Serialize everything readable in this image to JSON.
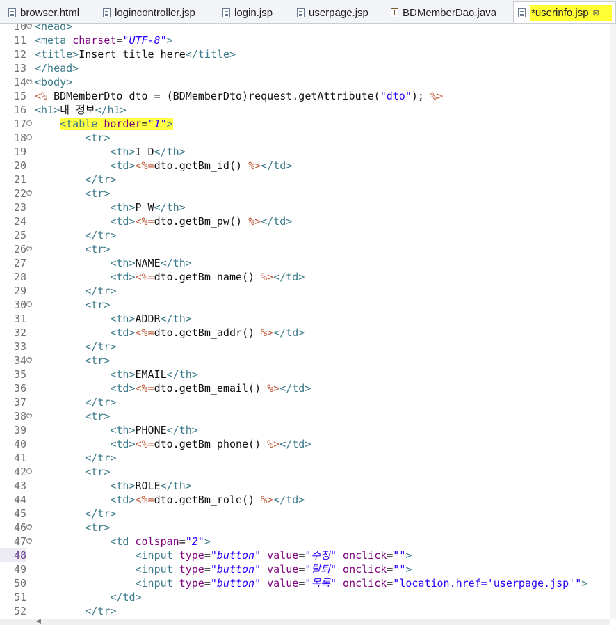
{
  "tabs": [
    {
      "label": "browser.html",
      "icon": "file-icon"
    },
    {
      "label": "logincontroller.jsp",
      "icon": "file-icon"
    },
    {
      "label": "login.jsp",
      "icon": "file-icon"
    },
    {
      "label": "userpage.jsp",
      "icon": "file-icon"
    },
    {
      "label": "BDMemberDao.java",
      "icon": "java-file-icon"
    },
    {
      "label": "*userinfo.jsp",
      "icon": "file-icon",
      "active": true,
      "close": "⊠"
    }
  ],
  "editor": {
    "current_line": "48",
    "lines": [
      {
        "n": "10",
        "fold": true,
        "parts": [
          [
            "tag",
            "<head>"
          ]
        ]
      },
      {
        "n": "11",
        "parts": [
          [
            "tag",
            "<meta "
          ],
          [
            "attr",
            "charset"
          ],
          [
            "txt",
            "="
          ],
          [
            "str",
            "\"UTF-8\""
          ],
          [
            "tag",
            ">"
          ]
        ]
      },
      {
        "n": "12",
        "parts": [
          [
            "tag",
            "<title>"
          ],
          [
            "txt",
            "Insert title here"
          ],
          [
            "tag",
            "</title>"
          ]
        ]
      },
      {
        "n": "13",
        "parts": [
          [
            "tag",
            "</head>"
          ]
        ]
      },
      {
        "n": "14",
        "fold": true,
        "parts": [
          [
            "tag",
            "<body>"
          ]
        ]
      },
      {
        "n": "15",
        "parts": [
          [
            "jsp",
            "<%"
          ],
          [
            "txt",
            " BDMemberDto dto = (BDMemberDto)request.getAttribute("
          ],
          [
            "dstr",
            "\"dto\""
          ],
          [
            "txt",
            "); "
          ],
          [
            "jsp",
            "%>"
          ]
        ]
      },
      {
        "n": "16",
        "parts": [
          [
            "tag",
            "<h1>"
          ],
          [
            "txt",
            "내 정보"
          ],
          [
            "tag",
            "</h1>"
          ]
        ]
      },
      {
        "n": "17",
        "fold": true,
        "indent": "    ",
        "highlight": true,
        "parts": [
          [
            "tag",
            "<table "
          ],
          [
            "attr",
            "border"
          ],
          [
            "txt",
            "="
          ],
          [
            "str",
            "\"1\""
          ],
          [
            "tag",
            ">"
          ]
        ]
      },
      {
        "n": "18",
        "fold": true,
        "indent": "        ",
        "parts": [
          [
            "tag",
            "<tr>"
          ]
        ]
      },
      {
        "n": "19",
        "indent": "            ",
        "parts": [
          [
            "tag",
            "<th>"
          ],
          [
            "txt",
            "I D"
          ],
          [
            "tag",
            "</th>"
          ]
        ]
      },
      {
        "n": "20",
        "indent": "            ",
        "parts": [
          [
            "tag",
            "<td>"
          ],
          [
            "jsp",
            "<%="
          ],
          [
            "txt",
            "dto.getBm_id() "
          ],
          [
            "jsp",
            "%>"
          ],
          [
            "tag",
            "</td>"
          ]
        ]
      },
      {
        "n": "21",
        "indent": "        ",
        "parts": [
          [
            "tag",
            "</tr>"
          ]
        ]
      },
      {
        "n": "22",
        "fold": true,
        "indent": "        ",
        "parts": [
          [
            "tag",
            "<tr>"
          ]
        ]
      },
      {
        "n": "23",
        "indent": "            ",
        "parts": [
          [
            "tag",
            "<th>"
          ],
          [
            "txt",
            "P W"
          ],
          [
            "tag",
            "</th>"
          ]
        ]
      },
      {
        "n": "24",
        "indent": "            ",
        "parts": [
          [
            "tag",
            "<td>"
          ],
          [
            "jsp",
            "<%="
          ],
          [
            "txt",
            "dto.getBm_pw() "
          ],
          [
            "jsp",
            "%>"
          ],
          [
            "tag",
            "</td>"
          ]
        ]
      },
      {
        "n": "25",
        "indent": "        ",
        "parts": [
          [
            "tag",
            "</tr>"
          ]
        ]
      },
      {
        "n": "26",
        "fold": true,
        "indent": "        ",
        "parts": [
          [
            "tag",
            "<tr>"
          ]
        ]
      },
      {
        "n": "27",
        "indent": "            ",
        "parts": [
          [
            "tag",
            "<th>"
          ],
          [
            "txt",
            "NAME"
          ],
          [
            "tag",
            "</th>"
          ]
        ]
      },
      {
        "n": "28",
        "indent": "            ",
        "parts": [
          [
            "tag",
            "<td>"
          ],
          [
            "jsp",
            "<%="
          ],
          [
            "txt",
            "dto.getBm_name() "
          ],
          [
            "jsp",
            "%>"
          ],
          [
            "tag",
            "</td>"
          ]
        ]
      },
      {
        "n": "29",
        "indent": "        ",
        "parts": [
          [
            "tag",
            "</tr>"
          ]
        ]
      },
      {
        "n": "30",
        "fold": true,
        "indent": "        ",
        "parts": [
          [
            "tag",
            "<tr>"
          ]
        ]
      },
      {
        "n": "31",
        "indent": "            ",
        "parts": [
          [
            "tag",
            "<th>"
          ],
          [
            "txt",
            "ADDR"
          ],
          [
            "tag",
            "</th>"
          ]
        ]
      },
      {
        "n": "32",
        "indent": "            ",
        "parts": [
          [
            "tag",
            "<td>"
          ],
          [
            "jsp",
            "<%="
          ],
          [
            "txt",
            "dto.getBm_addr() "
          ],
          [
            "jsp",
            "%>"
          ],
          [
            "tag",
            "</td>"
          ]
        ]
      },
      {
        "n": "33",
        "indent": "        ",
        "parts": [
          [
            "tag",
            "</tr>"
          ]
        ]
      },
      {
        "n": "34",
        "fold": true,
        "indent": "        ",
        "parts": [
          [
            "tag",
            "<tr>"
          ]
        ]
      },
      {
        "n": "35",
        "indent": "            ",
        "parts": [
          [
            "tag",
            "<th>"
          ],
          [
            "txt",
            "EMAIL"
          ],
          [
            "tag",
            "</th>"
          ]
        ]
      },
      {
        "n": "36",
        "indent": "            ",
        "parts": [
          [
            "tag",
            "<td>"
          ],
          [
            "jsp",
            "<%="
          ],
          [
            "txt",
            "dto.getBm_email() "
          ],
          [
            "jsp",
            "%>"
          ],
          [
            "tag",
            "</td>"
          ]
        ]
      },
      {
        "n": "37",
        "indent": "        ",
        "parts": [
          [
            "tag",
            "</tr>"
          ]
        ]
      },
      {
        "n": "38",
        "fold": true,
        "indent": "        ",
        "parts": [
          [
            "tag",
            "<tr>"
          ]
        ]
      },
      {
        "n": "39",
        "indent": "            ",
        "parts": [
          [
            "tag",
            "<th>"
          ],
          [
            "txt",
            "PHONE"
          ],
          [
            "tag",
            "</th>"
          ]
        ]
      },
      {
        "n": "40",
        "indent": "            ",
        "parts": [
          [
            "tag",
            "<td>"
          ],
          [
            "jsp",
            "<%="
          ],
          [
            "txt",
            "dto.getBm_phone() "
          ],
          [
            "jsp",
            "%>"
          ],
          [
            "tag",
            "</td>"
          ]
        ]
      },
      {
        "n": "41",
        "indent": "        ",
        "parts": [
          [
            "tag",
            "</tr>"
          ]
        ]
      },
      {
        "n": "42",
        "fold": true,
        "indent": "        ",
        "parts": [
          [
            "tag",
            "<tr>"
          ]
        ]
      },
      {
        "n": "43",
        "indent": "            ",
        "parts": [
          [
            "tag",
            "<th>"
          ],
          [
            "txt",
            "ROLE"
          ],
          [
            "tag",
            "</th>"
          ]
        ]
      },
      {
        "n": "44",
        "indent": "            ",
        "parts": [
          [
            "tag",
            "<td>"
          ],
          [
            "jsp",
            "<%="
          ],
          [
            "txt",
            "dto.getBm_role() "
          ],
          [
            "jsp",
            "%>"
          ],
          [
            "tag",
            "</td>"
          ]
        ]
      },
      {
        "n": "45",
        "indent": "        ",
        "parts": [
          [
            "tag",
            "</tr>"
          ]
        ]
      },
      {
        "n": "46",
        "fold": true,
        "indent": "        ",
        "parts": [
          [
            "tag",
            "<tr>"
          ]
        ]
      },
      {
        "n": "47",
        "fold": true,
        "indent": "            ",
        "parts": [
          [
            "tag",
            "<td "
          ],
          [
            "attr",
            "colspan"
          ],
          [
            "txt",
            "="
          ],
          [
            "str",
            "\"2\""
          ],
          [
            "tag",
            ">"
          ]
        ]
      },
      {
        "n": "48",
        "indent": "                ",
        "parts": [
          [
            "tag",
            "<input "
          ],
          [
            "attr",
            "type"
          ],
          [
            "txt",
            "="
          ],
          [
            "str",
            "\"button\""
          ],
          [
            "txt",
            " "
          ],
          [
            "attr",
            "value"
          ],
          [
            "txt",
            "="
          ],
          [
            "str",
            "\"수정\""
          ],
          [
            "txt",
            " "
          ],
          [
            "attr",
            "onclick"
          ],
          [
            "txt",
            "="
          ],
          [
            "dstr",
            "\"\""
          ],
          [
            "tag",
            ">"
          ]
        ]
      },
      {
        "n": "49",
        "indent": "                ",
        "parts": [
          [
            "tag",
            "<input "
          ],
          [
            "attr",
            "type"
          ],
          [
            "txt",
            "="
          ],
          [
            "str",
            "\"button\""
          ],
          [
            "txt",
            " "
          ],
          [
            "attr",
            "value"
          ],
          [
            "txt",
            "="
          ],
          [
            "str",
            "\"탈퇴\""
          ],
          [
            "txt",
            " "
          ],
          [
            "attr",
            "onclick"
          ],
          [
            "txt",
            "="
          ],
          [
            "dstr",
            "\"\""
          ],
          [
            "tag",
            ">"
          ]
        ]
      },
      {
        "n": "50",
        "indent": "                ",
        "parts": [
          [
            "tag",
            "<input "
          ],
          [
            "attr",
            "type"
          ],
          [
            "txt",
            "="
          ],
          [
            "str",
            "\"button\""
          ],
          [
            "txt",
            " "
          ],
          [
            "attr",
            "value"
          ],
          [
            "txt",
            "="
          ],
          [
            "str",
            "\"목록\""
          ],
          [
            "txt",
            " "
          ],
          [
            "attr",
            "onclick"
          ],
          [
            "txt",
            "="
          ],
          [
            "dstr",
            "\"location.href='userpage.jsp'\""
          ],
          [
            "tag",
            ">"
          ]
        ]
      },
      {
        "n": "51",
        "indent": "            ",
        "parts": [
          [
            "tag",
            "</td>"
          ]
        ]
      },
      {
        "n": "52",
        "indent": "        ",
        "parts": [
          [
            "tag",
            "</tr>"
          ]
        ]
      }
    ]
  },
  "colors": {
    "tag": "#3b7a8a",
    "attribute": "#7f007f",
    "string": "#2a00ff",
    "jsp_delimiter": "#bf5f3f",
    "highlight": "#ffff33"
  }
}
